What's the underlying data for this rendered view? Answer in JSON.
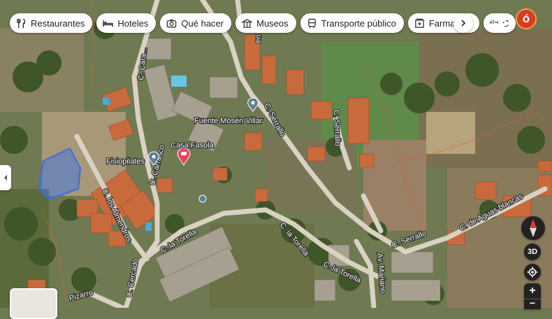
{
  "chips": [
    {
      "label": "Restaurantes",
      "icon": "fork-knife-icon"
    },
    {
      "label": "Hoteles",
      "icon": "bed-icon"
    },
    {
      "label": "Qué hacer",
      "icon": "camera-icon"
    },
    {
      "label": "Museos",
      "icon": "museum-icon"
    },
    {
      "label": "Transporte público",
      "icon": "bus-icon"
    },
    {
      "label": "Farmacias",
      "icon": "pharmacy-icon"
    },
    {
      "label": "C",
      "icon": "atm-icon",
      "prefix": "ATM"
    }
  ],
  "account": {
    "initial": "ó"
  },
  "controls": {
    "three_d": "3D",
    "zoom_in": "+",
    "zoom_out": "−"
  },
  "streets": {
    "villar": "en Villar",
    "serrallo": "C. Serrallo",
    "serrallo2": "C. Serrallo",
    "serrallo3": "C. Serrallo",
    "carrasco": "C. Carrasco",
    "caraballo": "C. Cara...",
    "almendros": "C. los Almendros",
    "torella": "C. la Torella",
    "torella2": "C. la Torella",
    "torella3": "C. la Torella",
    "aguas": "C. de Aguas blancas",
    "mariano": "Av. Mariano",
    "cercado": "C. Cercado",
    "pizarro": "Pizarro"
  },
  "places": {
    "fuente": "Fuente Mosén Villar",
    "casa": "Casa Fasola",
    "fisio": "Fisiopilates"
  },
  "colors": {
    "primary_pin": "#e8415a",
    "place_pin": "#5f7f94",
    "avatar": "#d93b23"
  }
}
